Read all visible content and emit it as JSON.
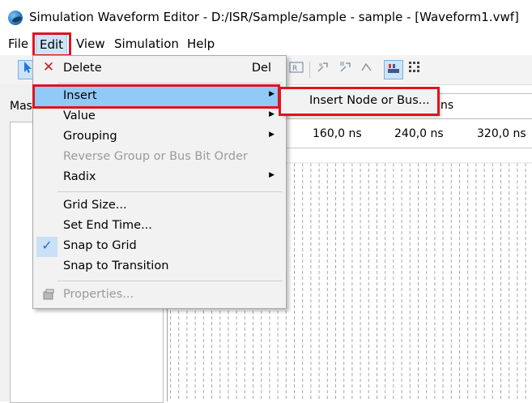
{
  "window": {
    "title": "Simulation Waveform Editor - D:/ISR/Sample/sample - sample - [Waveform1.vwf]"
  },
  "menubar": {
    "items": [
      {
        "label": "File"
      },
      {
        "label": "Edit"
      },
      {
        "label": "View"
      },
      {
        "label": "Simulation"
      },
      {
        "label": "Help"
      }
    ]
  },
  "left_panel": {
    "label": "Mas"
  },
  "value_box": {
    "text": "ns"
  },
  "time_ruler": {
    "ticks": [
      "160,0 ns",
      "240,0 ns",
      "320,0 ns"
    ]
  },
  "edit_menu": {
    "delete": {
      "label": "Delete",
      "shortcut": "Del",
      "icon": "delete-x-icon"
    },
    "insert": {
      "label": "Insert"
    },
    "value": {
      "label": "Value"
    },
    "grouping": {
      "label": "Grouping"
    },
    "reverse": {
      "label": "Reverse Group or Bus Bit Order"
    },
    "radix": {
      "label": "Radix"
    },
    "grid_size": {
      "label": "Grid Size..."
    },
    "set_end_time": {
      "label": "Set End Time..."
    },
    "snap_to_grid": {
      "label": "Snap to Grid",
      "checked": true
    },
    "snap_to_transition": {
      "label": "Snap to Transition"
    },
    "properties": {
      "label": "Properties...",
      "icon": "properties-icon"
    }
  },
  "insert_submenu": {
    "item": {
      "label": "Insert Node or Bus..."
    }
  },
  "colors": {
    "highlight_red": "#e0141e",
    "menu_hover": "#91c9f7",
    "menu_bg": "#f2f2f2"
  }
}
